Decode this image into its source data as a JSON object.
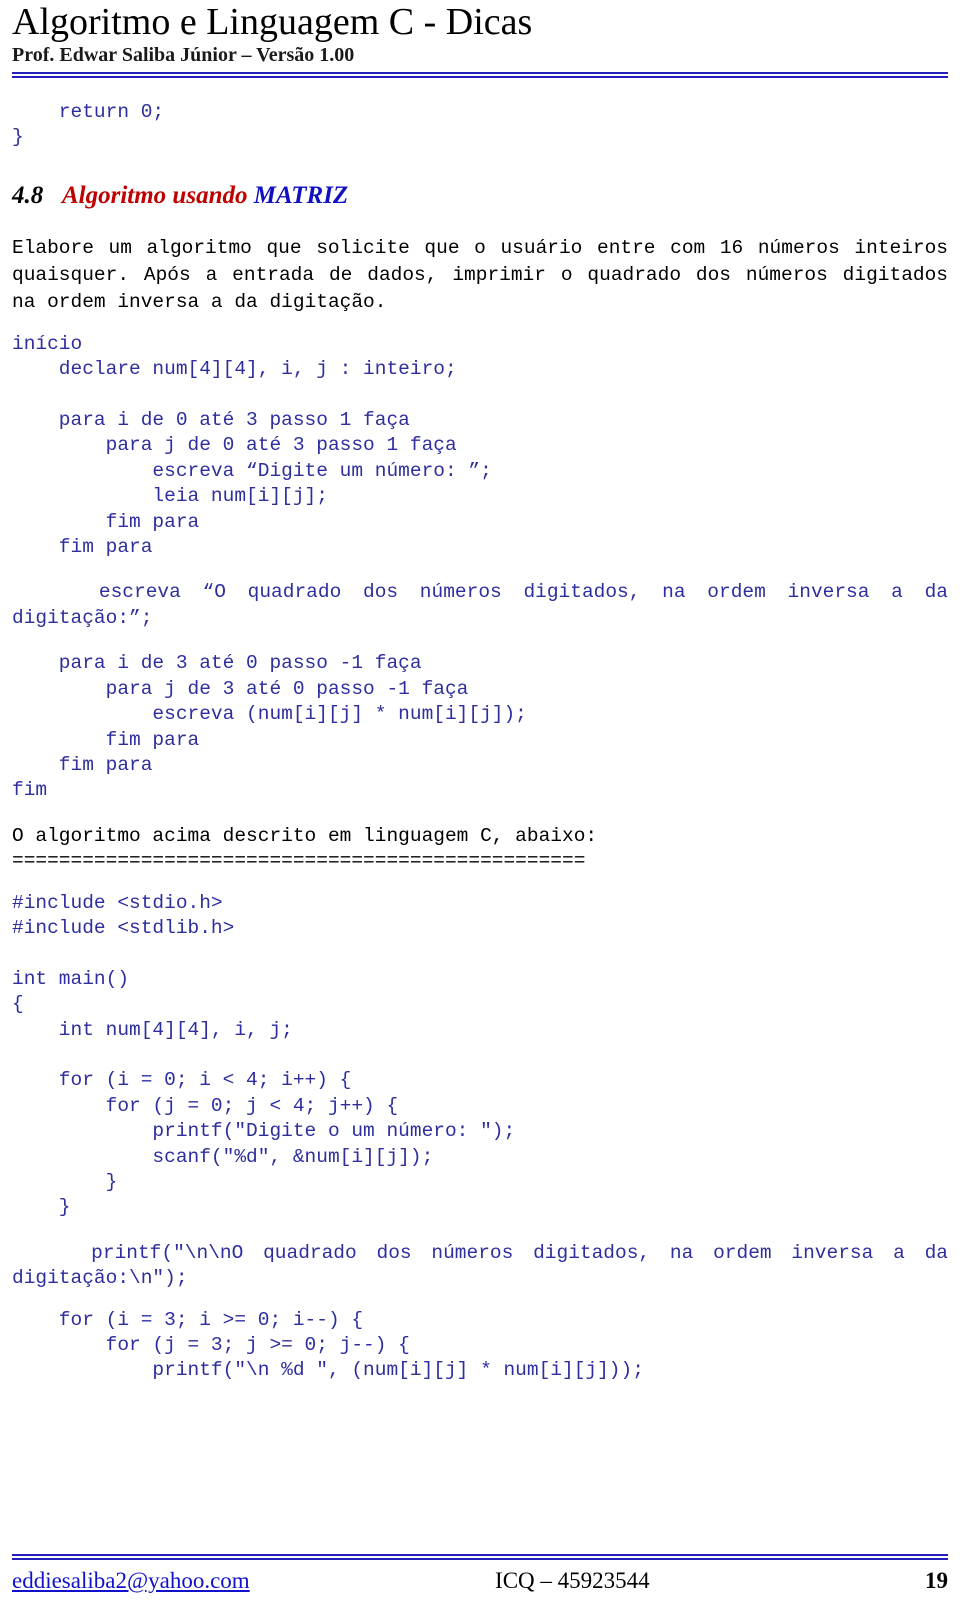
{
  "header": {
    "title": "Algoritmo e Linguagem C - Dicas",
    "subtitle": "Prof. Edwar Saliba Júnior – Versão 1.00",
    "rule_color": "#2222bb"
  },
  "top_code": {
    "lines": "    return 0;\n}",
    "color": "#2e2e9e"
  },
  "section": {
    "number": "4.8",
    "title_red": "Algoritmo usando ",
    "title_blue": "MATRIZ",
    "red_color": "#c00000",
    "blue_color": "#1010c0"
  },
  "statement": {
    "text": "Elabore um algoritmo que solicite que o usuário entre com 16 números inteiros quaisquer. Após a entrada de dados, imprimir o quadrado dos números digitados na ordem inversa a da digitação."
  },
  "pseudocode": {
    "part1": "início\n    declare num[4][4], i, j : inteiro;\n\n    para i de 0 até 3 passo 1 faça\n        para j de 0 até 3 passo 1 faça\n            escreva “Digite um número: ”;\n            leia num[i][j];\n        fim para\n    fim para",
    "part2": "    escreva “O quadrado dos números digitados, na ordem inversa a da digitação:”;",
    "part3": "    para i de 3 até 0 passo -1 faça\n        para j de 3 até 0 passo -1 faça\n            escreva (num[i][j] * num[i][j]);\n        fim para\n    fim para\nfim",
    "color": "#2e2e9e"
  },
  "note": {
    "text": "O algoritmo acima descrito em linguagem C, abaixo:",
    "separator": "================================================="
  },
  "c_code": {
    "part1": "#include <stdio.h>\n#include <stdlib.h>\n\nint main()\n{\n    int num[4][4], i, j;\n\n    for (i = 0; i < 4; i++) {\n        for (j = 0; j < 4; j++) {\n            printf(\"Digite o um número: \");\n            scanf(\"%d\", &num[i][j]);\n        }\n    }",
    "part2": "    printf(\"\\n\\nO quadrado dos números digitados, na ordem inversa a da digitação:\\n\");",
    "part3": "    for (i = 3; i >= 0; i--) {\n        for (j = 3; j >= 0; j--) {\n            printf(\"\\n %d \", (num[i][j] * num[i][j]));",
    "color": "#2e2e9e"
  },
  "footer": {
    "email": "eddiesaliba2@yahoo.com",
    "center": "ICQ – 45923544",
    "page": "19",
    "link_color": "#1111cc"
  }
}
